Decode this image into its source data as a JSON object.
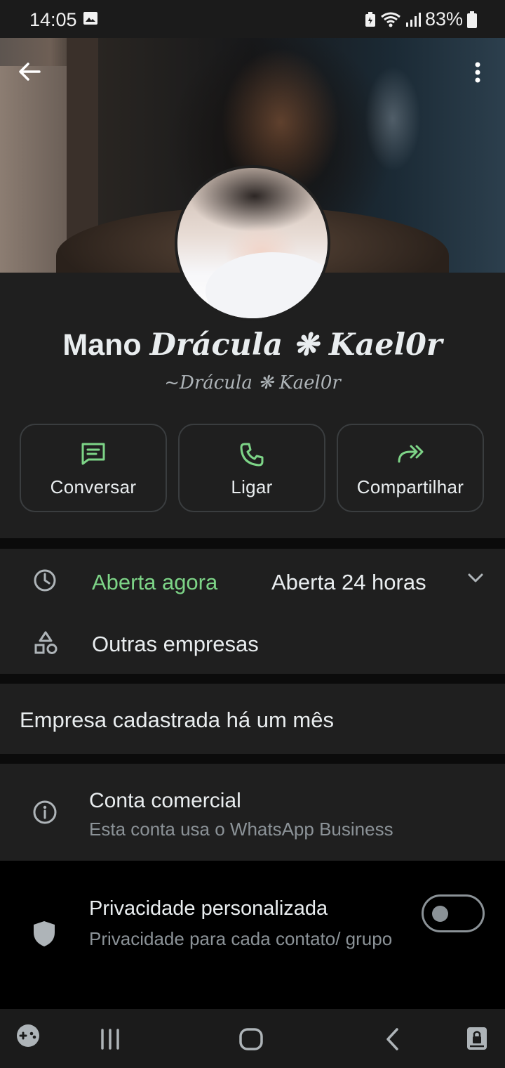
{
  "status_bar": {
    "time": "14:05",
    "battery": "83%",
    "icons": [
      "gallery-icon",
      "battery-saver-icon",
      "wifi-icon",
      "signal-icon",
      "battery-icon"
    ]
  },
  "header": {
    "back_icon": "back-arrow-icon",
    "menu_icon": "more-vert-icon"
  },
  "profile": {
    "name_plain": "Mano ",
    "name_fancy": "Drácula ❋ Kael0r",
    "subtitle": "~Drácula ❋ Kael0r"
  },
  "actions": [
    {
      "label": "Conversar",
      "icon": "chat-icon"
    },
    {
      "label": "Ligar",
      "icon": "phone-icon"
    },
    {
      "label": "Compartilhar",
      "icon": "share-forward-icon"
    }
  ],
  "business_hours": {
    "status": "Aberta agora",
    "hours": "Aberta 24 horas"
  },
  "other_businesses": {
    "label": "Outras empresas"
  },
  "registered": {
    "text": "Empresa cadastrada há um mês"
  },
  "account": {
    "title": "Conta comercial",
    "subtitle": "Esta conta usa o WhatsApp Business"
  },
  "privacy": {
    "title": "Privacidade personalizada",
    "subtitle": "Privacidade para cada contato/ grupo",
    "toggle_on": false
  },
  "colors": {
    "accent_green": "#7dd487",
    "background": "#1f1f1f"
  }
}
